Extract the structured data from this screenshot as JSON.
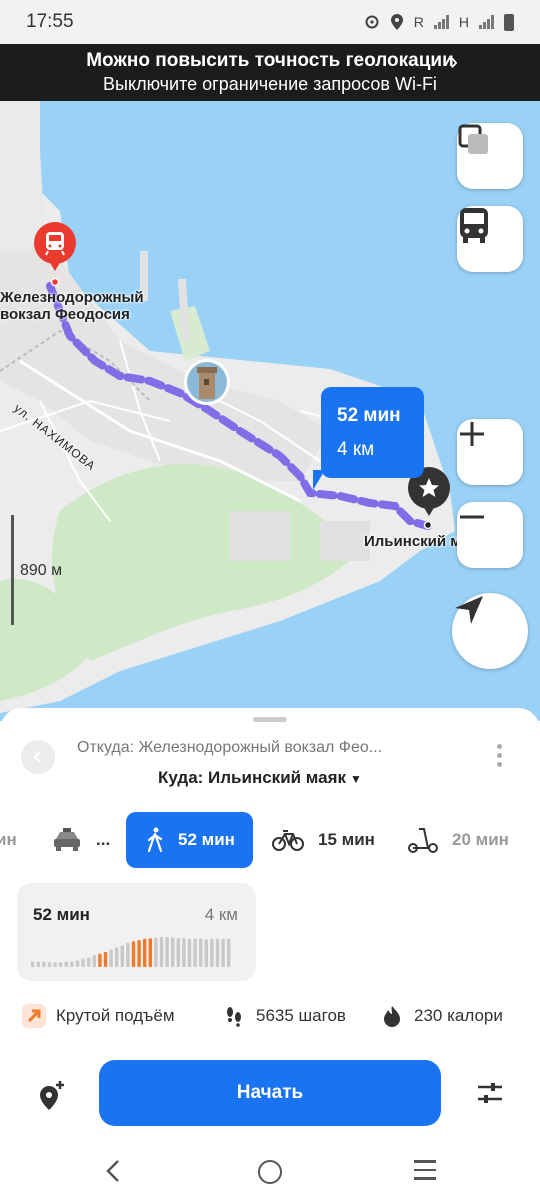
{
  "status_bar": {
    "time": "17:55",
    "carrier_r": "R",
    "carrier_h": "H"
  },
  "banner": {
    "line1": "Можно повысить точность геолокации",
    "line2": "Выключите ограничение запросов Wi-Fi",
    "chevron": "›"
  },
  "map": {
    "station_label_line1": "Железнодорожный",
    "station_label_line2": "вокзал Феодосия",
    "street_label": "ул. НАХИМОВА",
    "destination_label": "Ильинский маяк",
    "route_bubble": {
      "time": "52 мин",
      "distance": "4 км"
    },
    "scale": "890 м",
    "icons": [
      "layers-icon",
      "bus-icon",
      "zoom-in-icon",
      "zoom-out-icon",
      "my-location-icon",
      "train-pin-icon",
      "star-pin-icon",
      "tower-photo-icon"
    ]
  },
  "sheet": {
    "from": "Откуда: Железнодорожный вокзал Фео...",
    "to": "Куда: Ильинский маяк",
    "modes": [
      {
        "name": "transit-partial",
        "label": "ин"
      },
      {
        "name": "taxi",
        "label": "..."
      },
      {
        "name": "walk",
        "label": "52 мин",
        "active": true
      },
      {
        "name": "bike",
        "label": "15 мин"
      },
      {
        "name": "scooter",
        "label": "20 мин"
      }
    ],
    "card": {
      "time": "52 мин",
      "distance": "4 км"
    },
    "elevation_profile": [
      0.18,
      0.18,
      0.18,
      0.16,
      0.16,
      0.16,
      0.18,
      0.18,
      0.22,
      0.28,
      0.32,
      0.4,
      0.44,
      0.5,
      0.58,
      0.66,
      0.72,
      0.8,
      0.86,
      0.9,
      0.94,
      0.96,
      0.98,
      1.0,
      1.0,
      0.98,
      0.96,
      0.96,
      0.94,
      0.94,
      0.94,
      0.92,
      0.94,
      0.94,
      0.94,
      0.94
    ],
    "elevation_highlight": [
      12,
      13,
      18,
      19,
      20,
      21
    ],
    "stats": [
      {
        "name": "steep-climb",
        "label": "Крутой подъём"
      },
      {
        "name": "steps",
        "label": "5635 шагов"
      },
      {
        "name": "calories",
        "label": "230 калори"
      }
    ],
    "start_button": "Начать"
  },
  "colors": {
    "accent": "#1a73f0",
    "route": "#7f6ee6",
    "water": "#9ad2f7",
    "pin_red": "#ea3b2e",
    "climb_orange": "#f07a2a"
  }
}
